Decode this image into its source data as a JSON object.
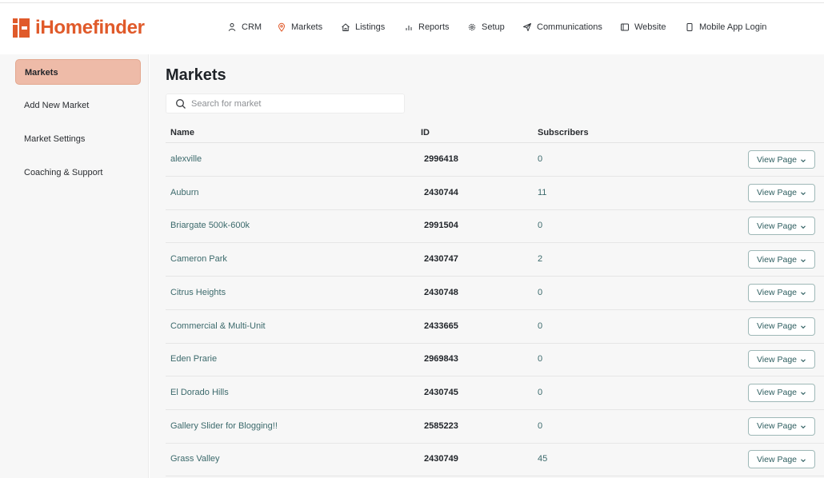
{
  "brand": {
    "name": "iHomefinder",
    "color": "#e05a2a"
  },
  "nav": [
    {
      "label": "CRM",
      "icon": "person-icon"
    },
    {
      "label": "Markets",
      "icon": "location-pin-icon"
    },
    {
      "label": "Listings",
      "icon": "home-icon"
    },
    {
      "label": "Reports",
      "icon": "bar-chart-icon"
    },
    {
      "label": "Setup",
      "icon": "gear-icon"
    },
    {
      "label": "Communications",
      "icon": "send-icon"
    },
    {
      "label": "Website",
      "icon": "browser-icon"
    },
    {
      "label": "Mobile App Login",
      "icon": "phone-icon"
    }
  ],
  "sidebar": {
    "items": [
      {
        "label": "Markets",
        "active": true
      },
      {
        "label": "Add New Market"
      },
      {
        "label": "Market Settings"
      },
      {
        "label": "Coaching & Support"
      }
    ]
  },
  "main": {
    "title": "Markets",
    "search": {
      "placeholder": "Search for market",
      "value": ""
    },
    "columns": [
      "Name",
      "ID",
      "Subscribers"
    ],
    "rows": [
      {
        "name": "alexville",
        "id": "2996418",
        "subscribers": "0",
        "action": "View Page"
      },
      {
        "name": "Auburn",
        "id": "2430744",
        "subscribers": "11",
        "action": "View Page"
      },
      {
        "name": "Briargate 500k-600k",
        "id": "2991504",
        "subscribers": "0",
        "action": "View Page"
      },
      {
        "name": "Cameron Park",
        "id": "2430747",
        "subscribers": "2",
        "action": "View Page"
      },
      {
        "name": "Citrus Heights",
        "id": "2430748",
        "subscribers": "0",
        "action": "View Page"
      },
      {
        "name": "Commercial & Multi-Unit",
        "id": "2433665",
        "subscribers": "0",
        "action": "View Page"
      },
      {
        "name": "Eden Prarie",
        "id": "2969843",
        "subscribers": "0",
        "action": "View Page"
      },
      {
        "name": "El Dorado Hills",
        "id": "2430745",
        "subscribers": "0",
        "action": "View Page"
      },
      {
        "name": "Gallery Slider for Blogging!!",
        "id": "2585223",
        "subscribers": "0",
        "action": "View Page"
      },
      {
        "name": "Grass Valley",
        "id": "2430749",
        "subscribers": "45",
        "action": "View Page"
      }
    ]
  }
}
